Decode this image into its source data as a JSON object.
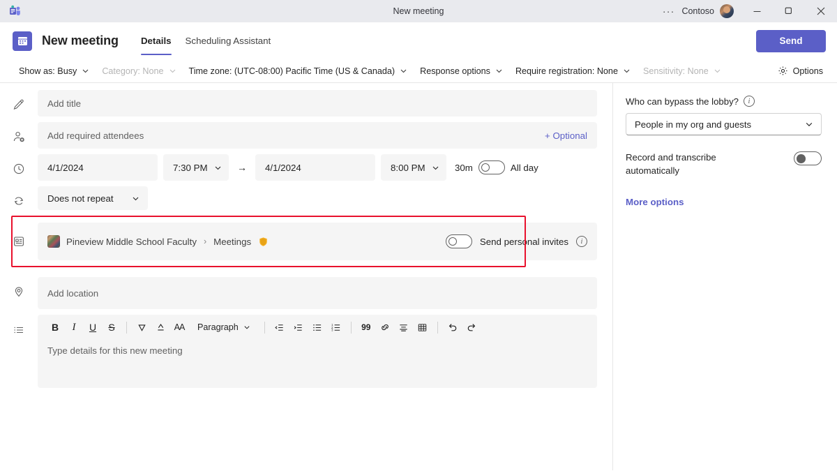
{
  "titlebar": {
    "app_icon": "teams-icon",
    "title": "New meeting",
    "ellipsis": "···",
    "org": "Contoso",
    "minimize": "—",
    "maximize": "❐",
    "close": "✕"
  },
  "header": {
    "title": "New meeting",
    "tabs": [
      {
        "label": "Details",
        "active": true
      },
      {
        "label": "Scheduling Assistant",
        "active": false
      }
    ],
    "send_label": "Send",
    "accent_color": "#5b5fc7"
  },
  "commandbar": {
    "items": [
      {
        "label": "Show as: Busy",
        "chevron": true,
        "disabled": false
      },
      {
        "label": "Category: None",
        "chevron": true,
        "disabled": true
      },
      {
        "label": "Time zone: (UTC-08:00) Pacific Time (US & Canada)",
        "chevron": true,
        "disabled": false
      },
      {
        "label": "Response options",
        "chevron": true,
        "disabled": false
      },
      {
        "label": "Require registration: None",
        "chevron": true,
        "disabled": false
      },
      {
        "label": "Sensitivity: None",
        "chevron": true,
        "disabled": true
      }
    ],
    "options_label": "Options"
  },
  "form": {
    "title_placeholder": "Add title",
    "attendees_placeholder": "Add required attendees",
    "optional_label": "+ Optional",
    "start_date": "4/1/2024",
    "start_time": "7:30 PM",
    "arrow": "→",
    "end_date": "4/1/2024",
    "end_time": "8:00 PM",
    "duration": "30m",
    "all_day_label": "All day",
    "all_day_on": false,
    "repeat_value": "Does not repeat",
    "location_placeholder": "Add location"
  },
  "channel": {
    "team_name": "Pineview Middle School Faculty",
    "separator": "›",
    "channel_name": "Meetings",
    "channel_badge": "🛡",
    "send_personal_invites_label": "Send personal invites",
    "send_personal_invites_on": false,
    "info_glyph": "i",
    "highlight_color": "#e8112d"
  },
  "editor": {
    "toolbar": [
      {
        "name": "bold",
        "glyph": "B"
      },
      {
        "name": "italic",
        "glyph": "I"
      },
      {
        "name": "underline",
        "glyph": "U"
      },
      {
        "name": "strikethrough",
        "glyph": "S"
      },
      {
        "name": "highlight",
        "glyph": ""
      },
      {
        "name": "font-color",
        "glyph": ""
      },
      {
        "name": "font-size",
        "glyph": "AA"
      },
      {
        "name": "paragraph",
        "glyph": "Paragraph"
      },
      {
        "name": "decrease-indent",
        "glyph": ""
      },
      {
        "name": "increase-indent",
        "glyph": ""
      },
      {
        "name": "bulleted-list",
        "glyph": ""
      },
      {
        "name": "numbered-list",
        "glyph": ""
      },
      {
        "name": "quote",
        "glyph": "99"
      },
      {
        "name": "link",
        "glyph": ""
      },
      {
        "name": "align",
        "glyph": ""
      },
      {
        "name": "table",
        "glyph": ""
      },
      {
        "name": "undo",
        "glyph": ""
      },
      {
        "name": "redo",
        "glyph": ""
      }
    ],
    "paragraph_label": "Paragraph",
    "aa_label": "AA",
    "quote_label": "99",
    "bold_label": "B",
    "italic_label": "I",
    "underline_label": "U",
    "strike_label": "S",
    "body_placeholder": "Type details for this new meeting"
  },
  "rightpanel": {
    "lobby_question": "Who can bypass the lobby?",
    "lobby_value": "People in my org and guests",
    "record_label": "Record and transcribe automatically",
    "record_on": true,
    "more_options": "More options",
    "info_glyph": "i"
  }
}
